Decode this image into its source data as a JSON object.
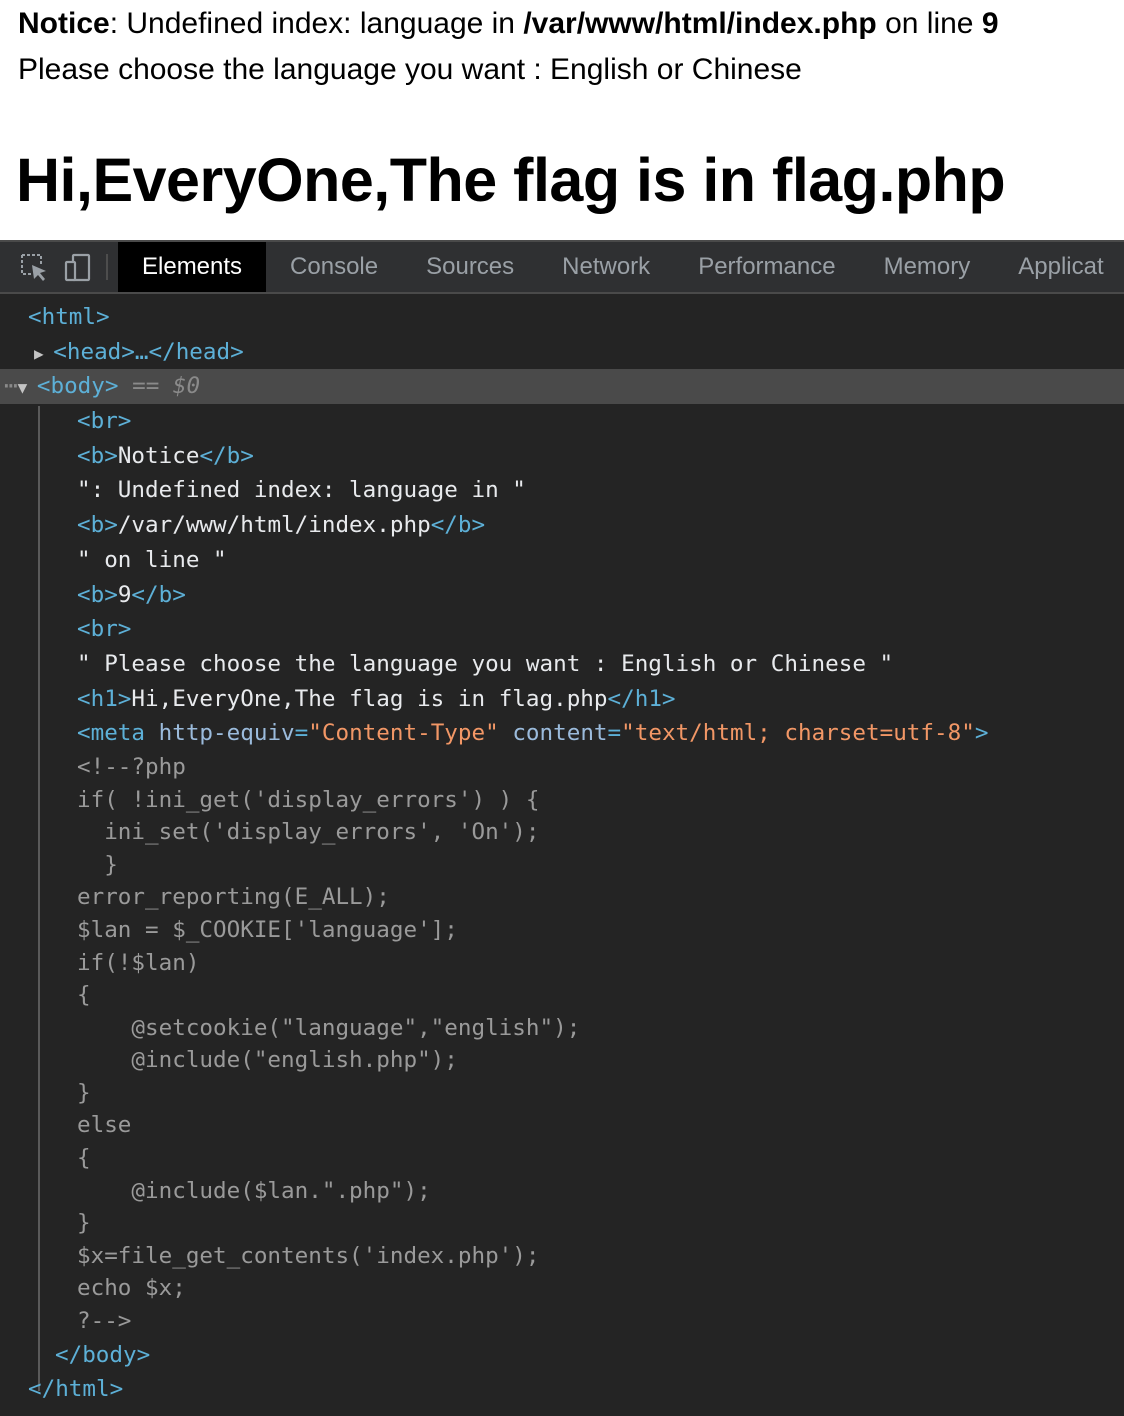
{
  "page": {
    "notice_label": "Notice",
    "notice_text": ": Undefined index: language in ",
    "notice_path": "/var/www/html/index.php",
    "notice_online": " on line ",
    "notice_line": "9",
    "choose_text": "Please choose the language you want : English or Chinese",
    "heading": "Hi,EveryOne,The flag is in flag.php"
  },
  "devtools": {
    "tabs": [
      "Elements",
      "Console",
      "Sources",
      "Network",
      "Performance",
      "Memory",
      "Applicat"
    ],
    "active_tab": "Elements",
    "icons": [
      "inspect-element-icon",
      "device-toolbar-icon"
    ],
    "tree": {
      "html_open": "<html>",
      "head": "<head>…</head>",
      "body_open": "<body>",
      "selected_marker": "== $0",
      "br": "<br>",
      "b_open": "<b>",
      "b_close": "</b>",
      "notice": "Notice",
      "text_undefined": "\": Undefined index: language in \"",
      "path": "/var/www/html/index.php",
      "text_online": "\" on line \"",
      "line_no": "9",
      "text_choose": "\" Please choose the language you want : English or Chinese \"",
      "h1_open": "<h1>",
      "h1_text": "Hi,EveryOne,The flag is in flag.php",
      "h1_close": "</h1>",
      "meta_open": "<meta ",
      "meta_attr1": "http-equiv",
      "meta_val1": "\"Content-Type\"",
      "meta_attr2": "content",
      "meta_val2": "\"text/html; charset=utf-8\"",
      "meta_close": ">",
      "comment_lines": [
        "<!--?php",
        "if( !ini_get('display_errors') ) {",
        "  ini_set('display_errors', 'On');",
        "  }",
        "error_reporting(E_ALL);",
        "$lan = $_COOKIE['language'];",
        "if(!$lan)",
        "{",
        "    @setcookie(\"language\",\"english\");",
        "    @include(\"english.php\");",
        "}",
        "else",
        "{",
        "    @include($lan.\".php\");",
        "}",
        "$x=file_get_contents('index.php');",
        "echo $x;",
        "?-->"
      ],
      "body_close": "</body>",
      "html_close": "</html>"
    }
  }
}
